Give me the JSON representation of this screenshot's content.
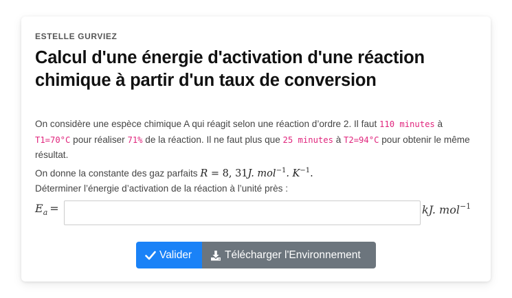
{
  "author": "ESTELLE GURVIEZ",
  "title": "Calcul d'une énergie d'activation d'une réaction chimique à partir d'un taux de conversion",
  "statement": {
    "s1": "On considère une espèce chimique A qui réagit selon une réaction d’ordre 2. Il faut ",
    "t1_duration": "110 minutes",
    "s2": " à ",
    "t1_temp": "T1=70°C",
    "s3": " pour réaliser ",
    "conversion": "71%",
    "s4": " de la réaction. Il ne faut plus que ",
    "t2_duration": "25 minutes",
    "s5": " à ",
    "t2_temp": "T2=94°C",
    "s6": " pour obtenir le même résultat.",
    "gas_intro": "On donne la constante des gaz parfaits ",
    "gas_lhs": "R",
    "gas_eq": " = ",
    "gas_value": "8, 31",
    "gas_unit_a": "J. mol",
    "gas_exp_a": "−1",
    "gas_unit_b": ". K",
    "gas_exp_b": "−1",
    "gas_end": ".",
    "question": "Déterminer l’énergie d’activation de la réaction à l’unité près :"
  },
  "answer": {
    "label_main": "E",
    "label_sub": "a",
    "label_eq": "=",
    "input_value": "",
    "unit_main": "kJ. mol",
    "unit_exp": "−1"
  },
  "buttons": {
    "validate_label": "Valider",
    "download_label": "Télécharger l'Environnement"
  },
  "icons": {
    "validate": "check-icon",
    "download": "download-icon"
  },
  "colors": {
    "validate_bg": "#1a82f7",
    "download_bg": "#6c757d",
    "code_text": "#e0247c"
  }
}
